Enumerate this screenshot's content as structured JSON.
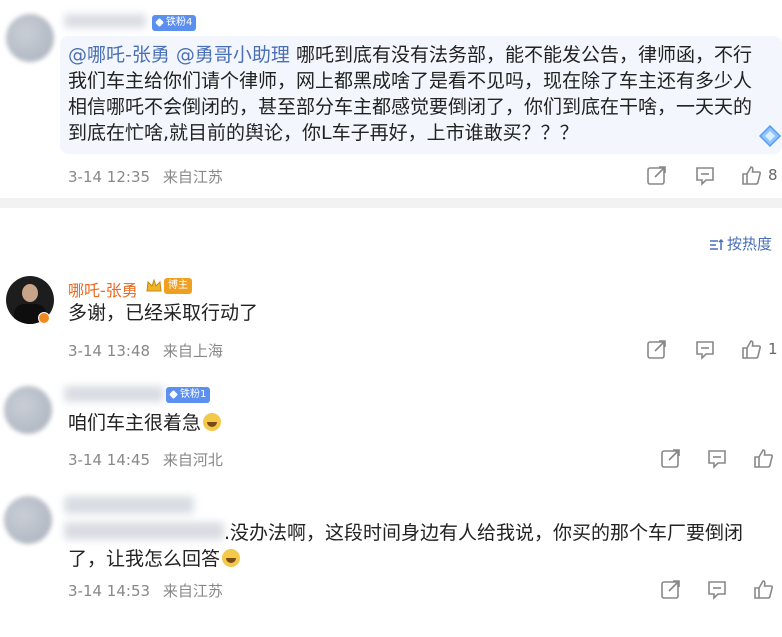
{
  "comments": [
    {
      "badge": "铁粉4",
      "mentions": [
        "@哪吒-张勇",
        "@勇哥小助理"
      ],
      "text_lines": [
        "哪吒到底有没有法务部，能不能发公告，律师函，不行",
        "我们车主给你们请个律师，网上都黑成啥了是看不见吗，现在除了车主还有多少人",
        "相信哪吒不会倒闭的，甚至部分车主都感觉要倒闭了，你们到底在干啥，一天天的",
        "到底在忙啥,就目前的舆论，你L车子再好，上市谁敢买？？？"
      ],
      "date": "3-14 12:35",
      "location": "来自江苏",
      "likes": "8"
    }
  ],
  "sort": {
    "label": "按热度"
  },
  "replies": [
    {
      "name": "哪吒-张勇",
      "tag": "博主",
      "text": "多谢，已经采取行动了",
      "date": "3-14 13:48",
      "location": "来自上海",
      "likes": "1"
    },
    {
      "badge": "铁粉1",
      "text": "咱们车主很着急",
      "date": "3-14 14:45",
      "location": "来自河北",
      "likes": ""
    },
    {
      "text_lines": [
        ".没办法啊，这段时间身边有人给我说，你买的那个车厂要倒闭",
        "了，让我怎么回答"
      ],
      "date": "3-14 14:53",
      "location": "来自江苏",
      "likes": ""
    }
  ],
  "icons": {
    "share": "share-icon",
    "comment": "comment-icon",
    "like": "thumbs-up-icon",
    "sort": "sort-icon",
    "crown": "crown-icon",
    "laugh_emoji": "laughing-crying-emoji"
  },
  "colors": {
    "mention": "#4a6fb5",
    "blogger_name": "#e86a20",
    "badge": "#5b8ff0",
    "meta_text": "#888888"
  }
}
